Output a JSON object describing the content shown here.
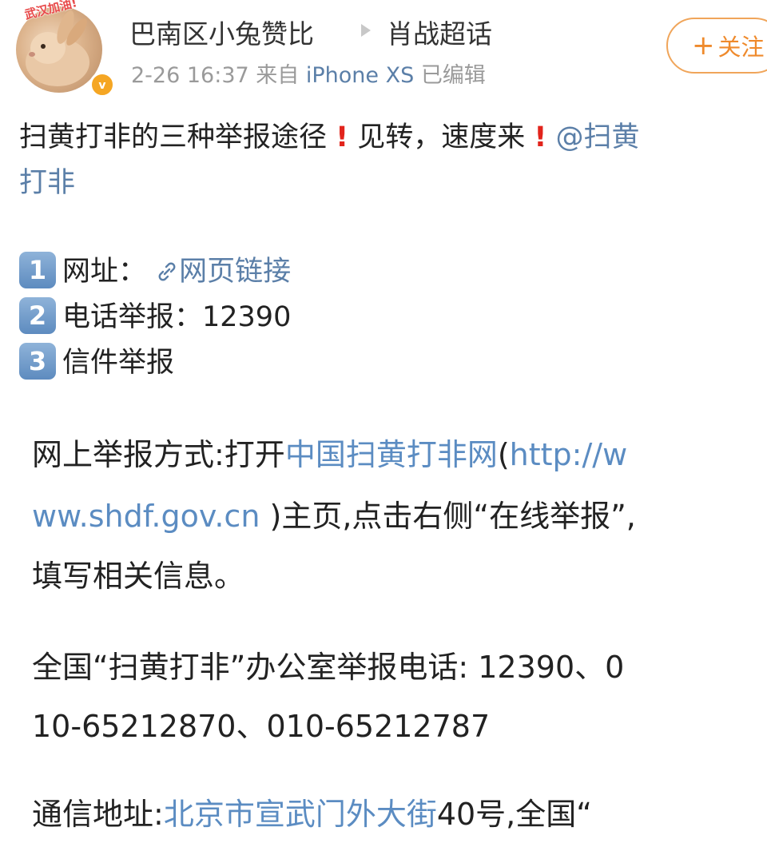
{
  "post": {
    "avatar_caption": "武汉加油!",
    "username": "巴南区小兔赞比",
    "topic": "肖战超话",
    "time": "2-26 16:37",
    "source_prefix": "来自",
    "device": "iPhone XS",
    "edited": "已编辑",
    "follow_label": "关注",
    "follow_plus": "+",
    "icons": {
      "verified": "verified-badge-icon",
      "arrow": "play-arrow-icon",
      "link": "link-icon",
      "exclamation": "red-exclamation-icon"
    },
    "colors": {
      "mention": "#5b7fa8",
      "link": "#5b8cc2",
      "follow": "#ef8a2c",
      "exclamation": "#e2241c"
    }
  },
  "intro": {
    "part1": "扫黄打非的三种举报途径",
    "part2": "见转，速度来",
    "mention_line1": "@扫黄",
    "mention_line2": "打非"
  },
  "methods": [
    {
      "badge": "1",
      "label": "网址：",
      "link": "网页链接"
    },
    {
      "badge": "2",
      "label": "电话举报：12390"
    },
    {
      "badge": "3",
      "label": "信件举报"
    }
  ],
  "online": {
    "prefix": "网上举报方式:打开",
    "site_name": "中国扫黄打非网",
    "paren_open": "(",
    "url_line1": "http://w",
    "url_line2": "ww.shdf.gov.cn",
    "suffix_line2": " )主页,点击右侧“在线举报”,",
    "line3": "填写相关信息。"
  },
  "phone": {
    "line1": "全国“扫黄打非”办公室举报电话: 12390、0",
    "line2": "10-65212870、010-65212787"
  },
  "address": {
    "prefix": "通信地址:",
    "street": "北京市宣武门外大街",
    "suffix": "40号,全国“"
  }
}
